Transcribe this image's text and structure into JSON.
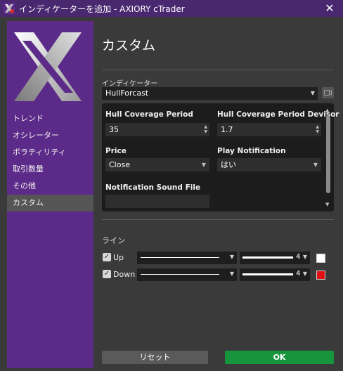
{
  "window": {
    "title": "インディケーターを追加 - AXIORY cTrader"
  },
  "colors": {
    "sidebar": "#5c2a88",
    "titlebar": "#4a2870",
    "ok_button": "#17953c",
    "up_color": "#ffffff",
    "down_color": "#e01010"
  },
  "sidebar": {
    "items": [
      {
        "label": "トレンド"
      },
      {
        "label": "オシレーター"
      },
      {
        "label": "ボラティリティ"
      },
      {
        "label": "取引数量"
      },
      {
        "label": "その他"
      },
      {
        "label": "カスタム",
        "active": true
      }
    ]
  },
  "main": {
    "title": "カスタム",
    "indicator_label": "インディケーター",
    "indicator_value": "HullForcast",
    "params": {
      "hull_period_label": "Hull Coverage Period",
      "hull_period_value": "35",
      "hull_divisor_label": "Hull Coverage Period Devisor",
      "hull_divisor_value": "1.7",
      "price_label": "Price",
      "price_value": "Close",
      "play_notification_label": "Play Notification",
      "play_notification_value": "はい",
      "sound_file_label": "Notification Sound File",
      "sound_file_value": ""
    },
    "lines_label": "ライン",
    "lines": [
      {
        "name": "Up",
        "checked": true,
        "width": "4",
        "color": "#ffffff"
      },
      {
        "name": "Down",
        "checked": true,
        "width": "4",
        "color": "#e01010"
      }
    ],
    "reset_label": "リセット",
    "ok_label": "OK"
  }
}
